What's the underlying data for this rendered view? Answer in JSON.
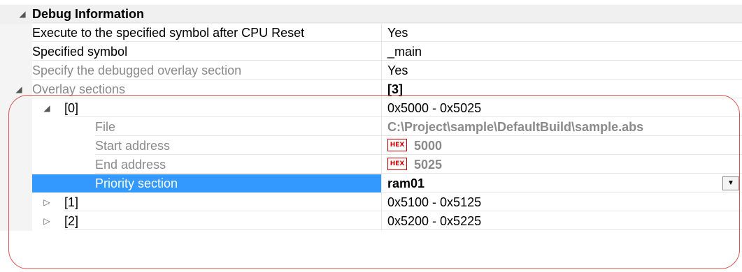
{
  "category": {
    "arrow": "◢",
    "label": "Debug Information"
  },
  "rows": [
    {
      "label": "Execute to the specified symbol after CPU Reset",
      "value": "Yes"
    },
    {
      "label": "Specified symbol",
      "value": "_main"
    },
    {
      "label": "Specify the debugged overlay section",
      "value": "Yes"
    }
  ],
  "overlay": {
    "arrow": "◢",
    "label": "Overlay sections",
    "value": "[3]",
    "entries": [
      {
        "arrow": "◢",
        "label": "[0]",
        "value": "0x5000 - 0x5025",
        "children": {
          "file_label": "File",
          "file_value": "C:\\Project\\sample\\DefaultBuild\\sample.abs",
          "start_label": "Start address",
          "start_badge": "HEX",
          "start_value": "5000",
          "end_label": "End address",
          "end_badge": "HEX",
          "end_value": "5025",
          "priority_label": "Priority section",
          "priority_value": "ram01",
          "dropdown_icon": "chevron-down-icon"
        }
      },
      {
        "arrow": "▷",
        "label": "[1]",
        "value": "0x5100 - 0x5125"
      },
      {
        "arrow": "▷",
        "label": "[2]",
        "value": "0x5200 - 0x5225"
      }
    ]
  },
  "colors": {
    "selection": "#3399ff",
    "annotation": "#d9534f",
    "hex_badge": "#cc0000"
  }
}
